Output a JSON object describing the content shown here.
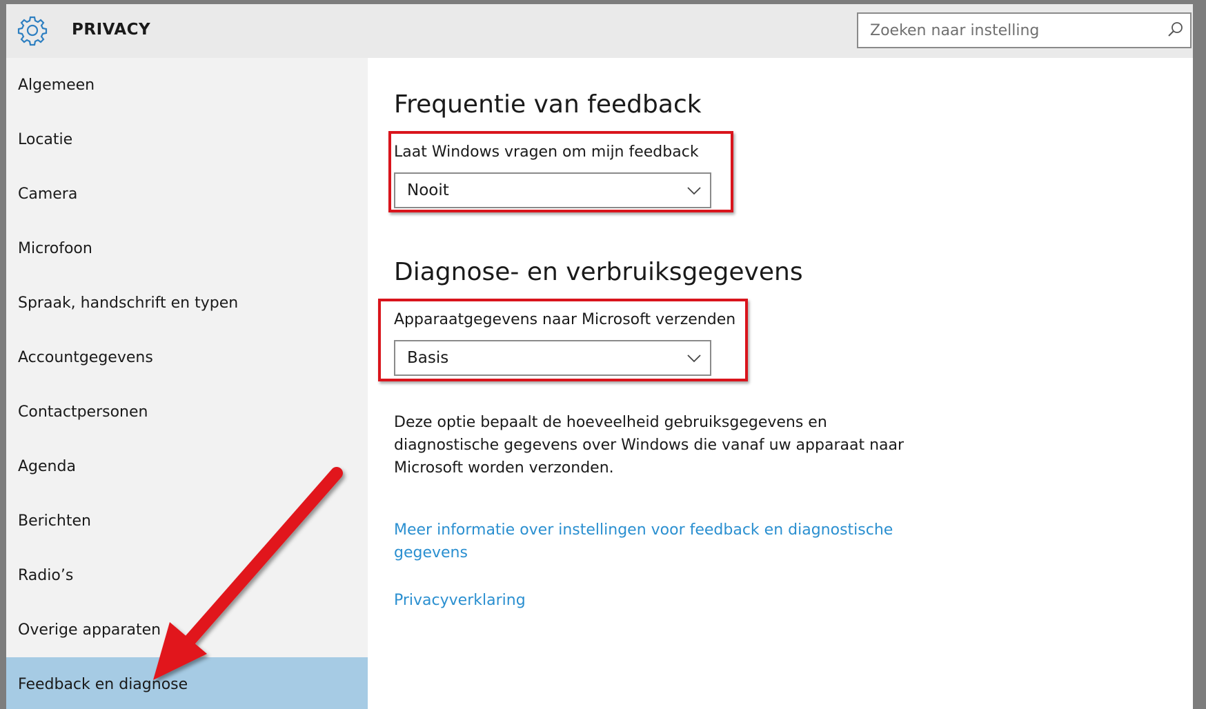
{
  "header": {
    "title": "PRIVACY",
    "search_placeholder": "Zoeken naar instelling"
  },
  "sidebar": {
    "items": [
      {
        "label": "Algemeen"
      },
      {
        "label": "Locatie"
      },
      {
        "label": "Camera"
      },
      {
        "label": "Microfoon"
      },
      {
        "label": "Spraak, handschrift en typen"
      },
      {
        "label": "Accountgegevens"
      },
      {
        "label": "Contactpersonen"
      },
      {
        "label": "Agenda"
      },
      {
        "label": "Berichten"
      },
      {
        "label": "Radio’s"
      },
      {
        "label": "Overige apparaten"
      },
      {
        "label": "Feedback en diagnose"
      }
    ],
    "selected": "Feedback en diagnose"
  },
  "feedback": {
    "heading": "Frequentie van feedback",
    "label": "Laat Windows vragen om mijn feedback",
    "value": "Nooit"
  },
  "diagnostics": {
    "heading": "Diagnose- en verbruiksgegevens",
    "label": "Apparaatgegevens naar Microsoft verzenden",
    "value": "Basis",
    "description_lines": [
      "Deze optie bepaalt de hoeveelheid gebruiksgegevens en",
      "diagnostische gegevens over Windows die vanaf uw apparaat naar",
      "Microsoft worden verzonden."
    ]
  },
  "links": {
    "more_info_lines": [
      "Meer informatie over instellingen voor feedback en diagnostische",
      "gegevens"
    ],
    "privacy": "Privacyverklaring"
  },
  "colors": {
    "accent": "#2a8fd0",
    "selected_bg": "#a6cbe4",
    "highlight": "#d9141c"
  }
}
